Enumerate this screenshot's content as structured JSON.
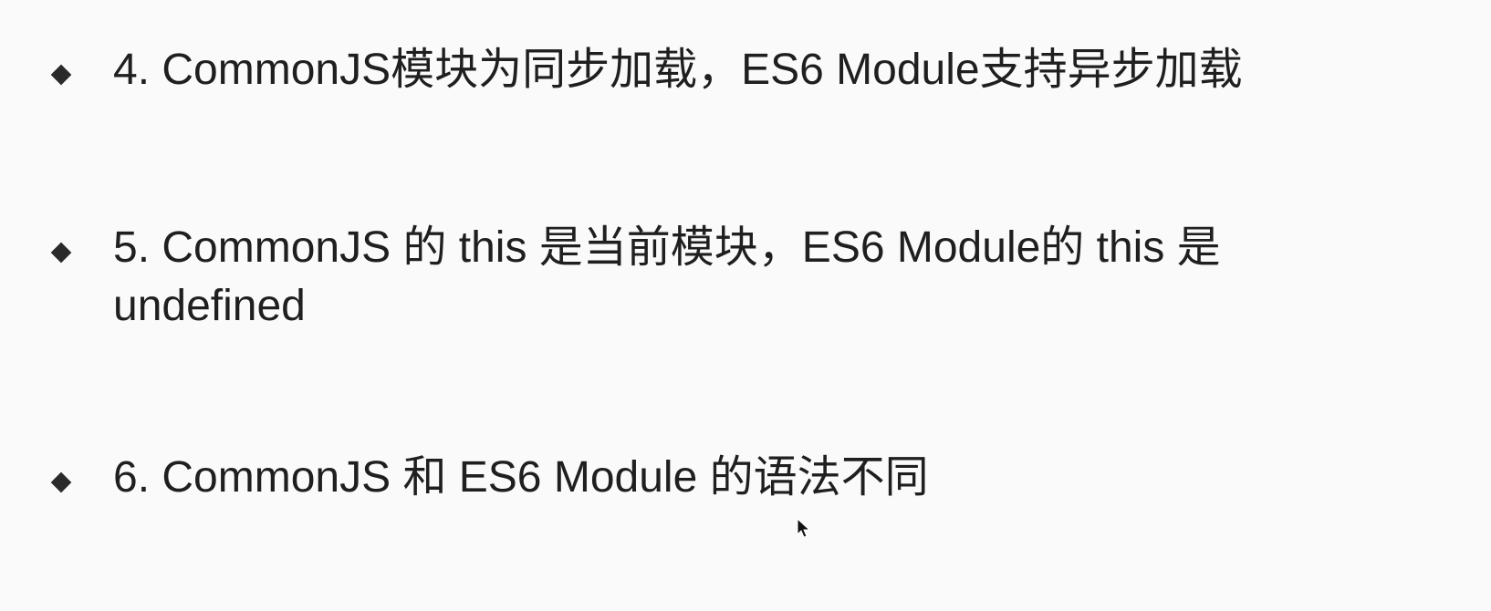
{
  "bullets": [
    {
      "text": "4. CommonJS模块为同步加载，ES6 Module支持异步加载",
      "marker_icon": "diamond-bullet-icon"
    },
    {
      "text": "5. CommonJS 的 this 是当前模块，ES6 Module的 this 是 undefined",
      "marker_icon": "diamond-bullet-icon"
    },
    {
      "text": "6. CommonJS 和 ES6 Module 的语法不同",
      "marker_icon": "diamond-bullet-icon"
    }
  ],
  "colors": {
    "background": "#fafafa",
    "text": "#1f1f1f",
    "bullet": "#2a2a2a"
  },
  "cursor_icon": "mouse-pointer-icon"
}
